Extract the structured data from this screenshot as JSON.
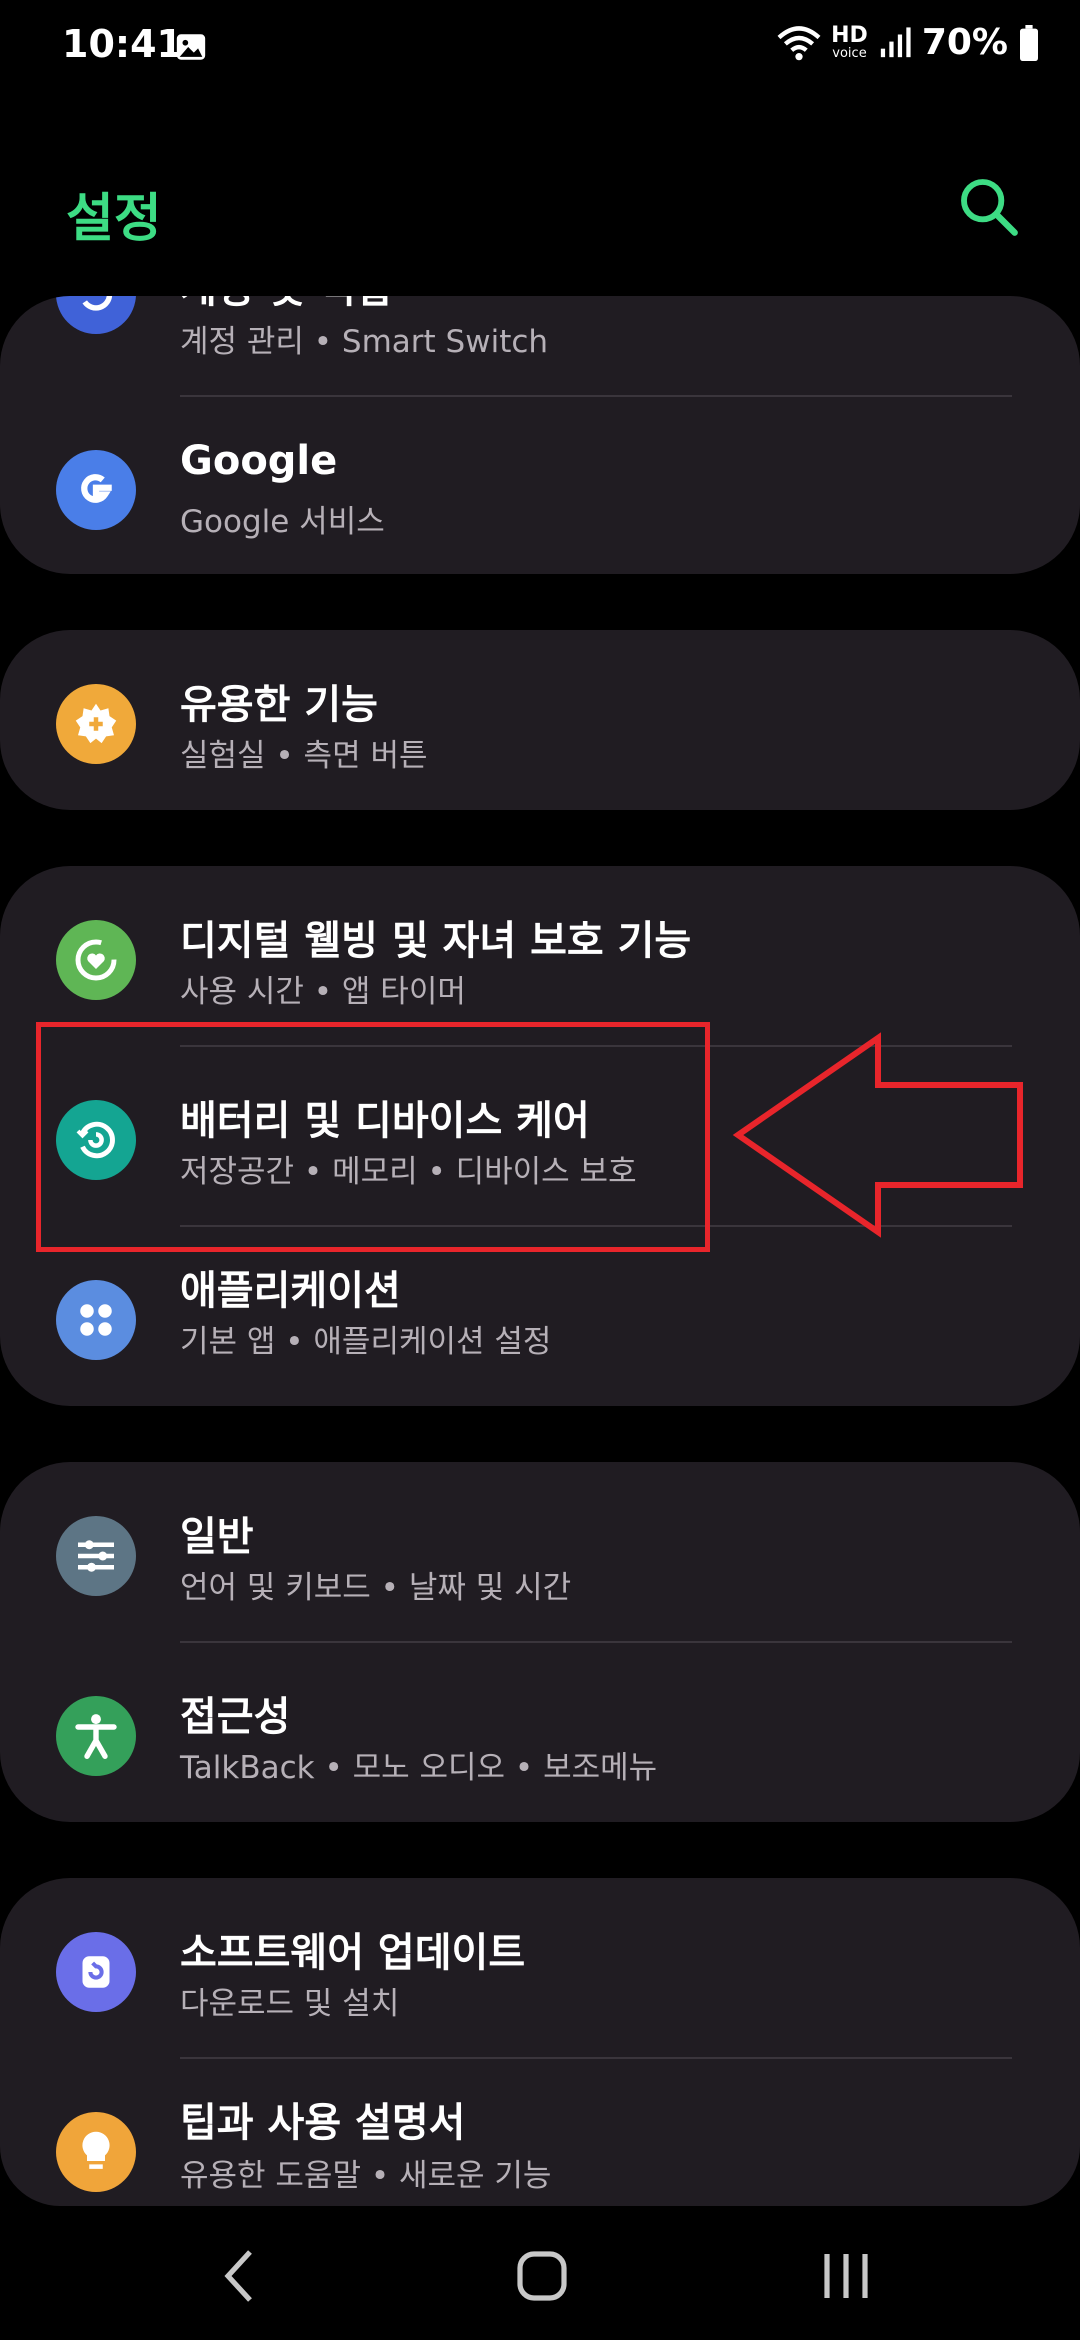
{
  "status_bar": {
    "time": "10:41",
    "network_label": "HD",
    "network_sub": "voice",
    "battery": "70%",
    "icons": [
      "gallery-icon",
      "wifi-icon",
      "hd-voice-icon",
      "signal-icon",
      "battery-icon"
    ]
  },
  "header": {
    "title": "설정",
    "search_icon": "search-icon"
  },
  "groups": [
    {
      "items": [
        {
          "title": "계정 및 백업",
          "subtitle": "계정 관리 • Smart Switch",
          "icon": "sync-icon",
          "color": "#4062d8"
        },
        {
          "title": "Google",
          "subtitle": "Google 서비스",
          "icon": "google-icon",
          "color": "#4a7ee8"
        }
      ]
    },
    {
      "items": [
        {
          "title": "유용한 기능",
          "subtitle": "실험실 • 측면 버튼",
          "icon": "puzzle-icon",
          "color": "#f0a93a"
        }
      ]
    },
    {
      "items": [
        {
          "title": "디지털 웰빙 및 자녀 보호 기능",
          "subtitle": "사용 시간 • 앱 타이머",
          "icon": "wellbeing-icon",
          "color": "#5fb655"
        },
        {
          "title": "배터리 및 디바이스 케어",
          "subtitle": "저장공간 • 메모리 • 디바이스 보호",
          "icon": "device-care-icon",
          "color": "#14a592"
        },
        {
          "title": "애플리케이션",
          "subtitle": "기본 앱 • 애플리케이션 설정",
          "icon": "apps-icon",
          "color": "#5b8de0"
        }
      ]
    },
    {
      "items": [
        {
          "title": "일반",
          "subtitle": "언어 및 키보드 • 날짜 및 시간",
          "icon": "sliders-icon",
          "color": "#5d7585"
        },
        {
          "title": "접근성",
          "subtitle": "TalkBack • 모노 오디오 • 보조메뉴",
          "icon": "accessibility-icon",
          "color": "#34a05a"
        }
      ]
    },
    {
      "items": [
        {
          "title": "소프트웨어 업데이트",
          "subtitle": "다운로드 및 설치",
          "icon": "software-update-icon",
          "color": "#6a6ee8"
        },
        {
          "title": "팁과 사용 설명서",
          "subtitle": "유용한 도움말 • 새로운 기능",
          "icon": "bulb-icon",
          "color": "#f0a53a"
        }
      ]
    }
  ],
  "nav_bar": {
    "icons": [
      "back-icon",
      "home-icon",
      "recents-icon"
    ]
  },
  "annotation": {
    "color": "#e8252b"
  }
}
